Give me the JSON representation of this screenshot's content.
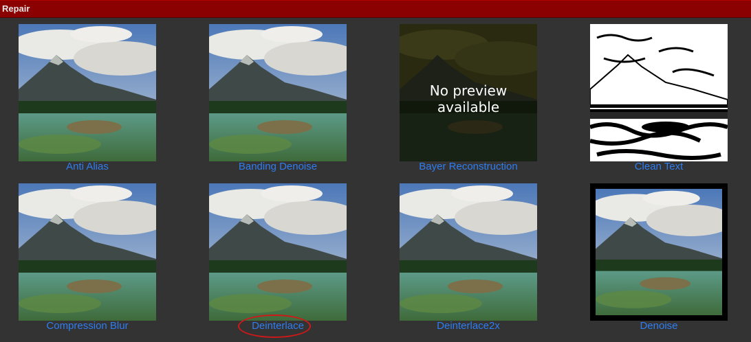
{
  "header": {
    "title": "Repair"
  },
  "thumb_overlay_text": "No preview available",
  "filters": [
    {
      "label": "Anti Alias",
      "style": "normal"
    },
    {
      "label": "Banding Denoise",
      "style": "normal"
    },
    {
      "label": "Bayer Reconstruction",
      "style": "dark"
    },
    {
      "label": "Clean Text",
      "style": "bw"
    },
    {
      "label": "Compression Blur",
      "style": "normal"
    },
    {
      "label": "Deinterlace",
      "style": "normal",
      "highlighted": true
    },
    {
      "label": "Deinterlace2x",
      "style": "normal"
    },
    {
      "label": "Denoise",
      "style": "framed"
    }
  ],
  "colors": {
    "background": "#333333",
    "header": "#8b0000",
    "label": "#2f7df0",
    "highlight_circle": "#d01818"
  }
}
